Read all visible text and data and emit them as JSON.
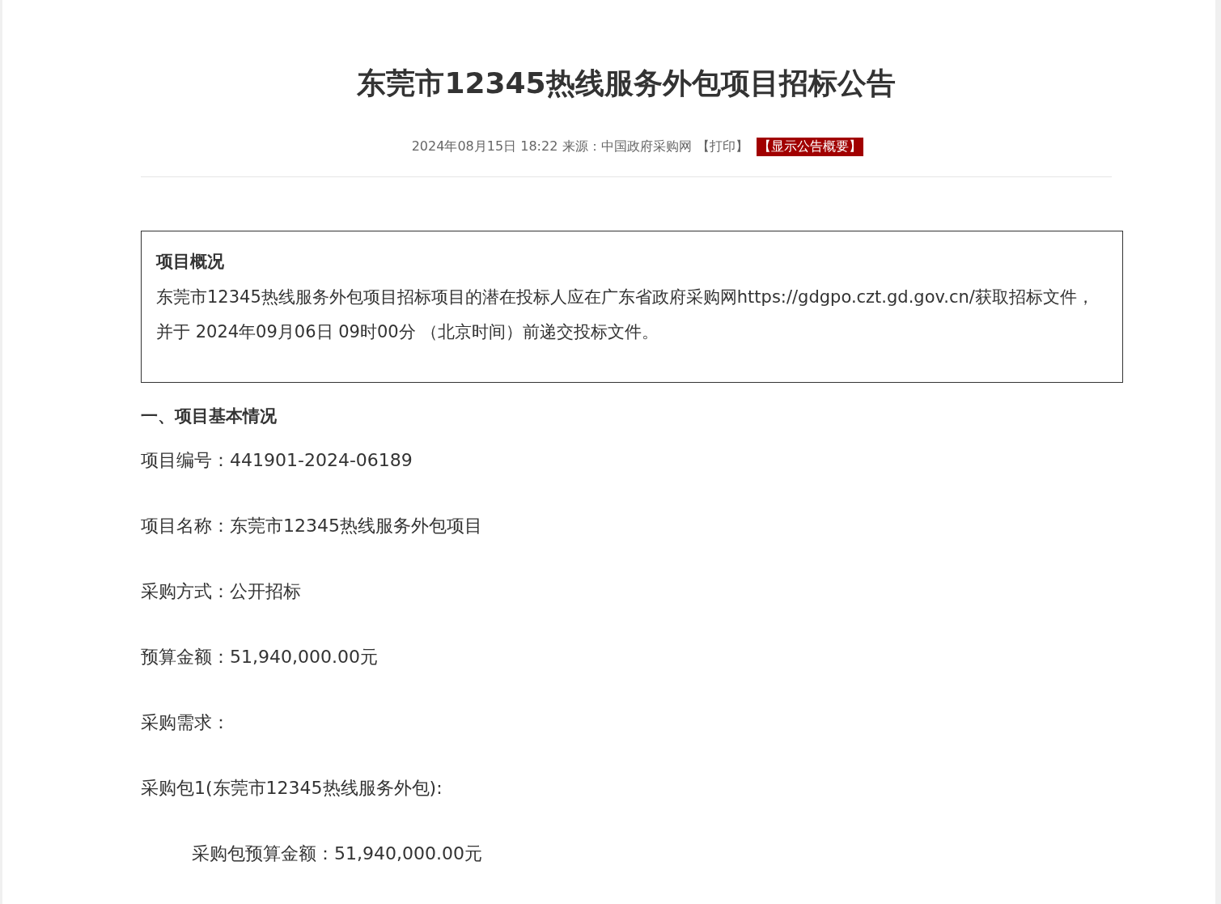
{
  "article": {
    "title": "东莞市12345热线服务外包项目招标公告",
    "meta": {
      "date": "2024年08月15日 18:22",
      "source_label": "来源：",
      "source": "中国政府采购网",
      "print_link": "【打印】",
      "summary_button": "【显示公告概要】"
    },
    "overview": {
      "heading": "项目概况",
      "text": "东莞市12345热线服务外包项目招标项目的潜在投标人应在广东省政府采购网https://gdgpo.czt.gd.gov.cn/获取招标文件，并于 2024年09月06日 09时00分 （北京时间）前递交投标文件。"
    },
    "section_heading": "一、项目基本情况",
    "lines": [
      {
        "kind": "line",
        "text": "项目编号：441901-2024-06189"
      },
      {
        "kind": "line",
        "text": "项目名称：东莞市12345热线服务外包项目"
      },
      {
        "kind": "line",
        "text": "采购方式：公开招标"
      },
      {
        "kind": "line",
        "text": "预算金额：51,940,000.00元"
      },
      {
        "kind": "line",
        "text": "采购需求："
      },
      {
        "kind": "line",
        "text": "采购包1(东莞市12345热线服务外包):"
      },
      {
        "kind": "indented",
        "text": "采购包预算金额：51,940,000.00元"
      }
    ]
  }
}
